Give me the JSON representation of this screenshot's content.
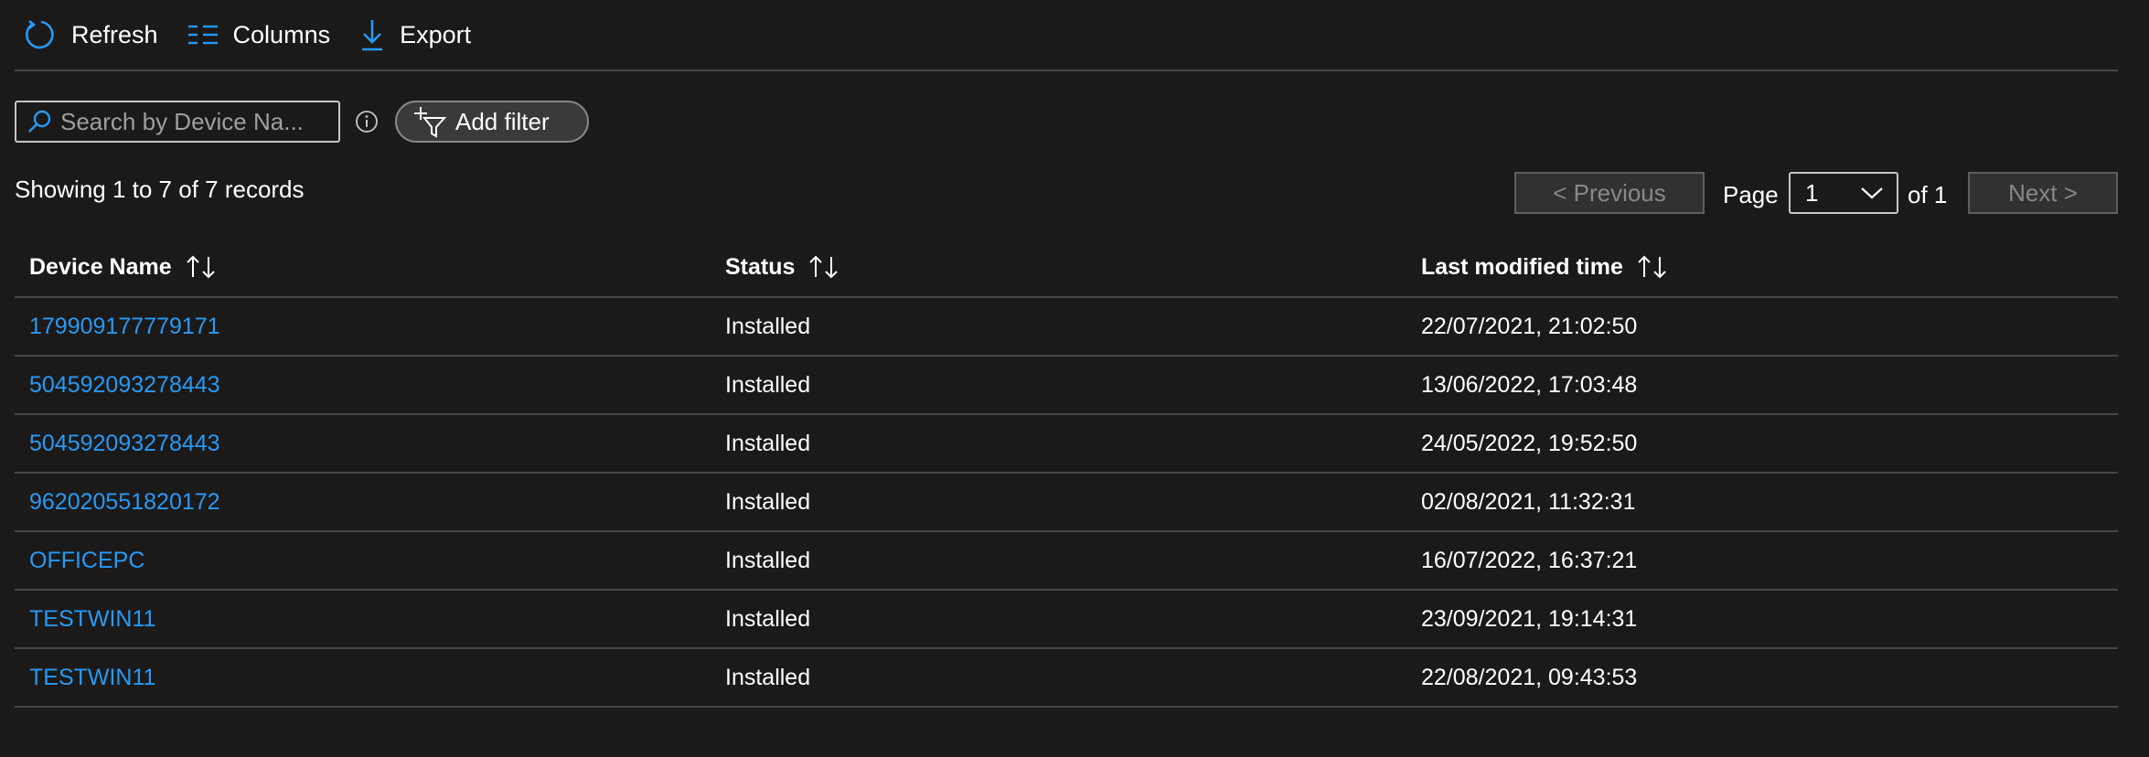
{
  "toolbar": {
    "refresh_label": "Refresh",
    "columns_label": "Columns",
    "export_label": "Export"
  },
  "filter": {
    "search_placeholder": "Search by Device Na...",
    "add_filter_label": "Add filter"
  },
  "records_text": "Showing 1 to 7 of 7 records",
  "pagination": {
    "previous_label": "< Previous",
    "page_label": "Page",
    "current_page": "1",
    "of_label": "of 1",
    "next_label": "Next >"
  },
  "table": {
    "headers": [
      "Device Name",
      "Status",
      "Last modified time"
    ],
    "rows": [
      [
        "179909177779171",
        "Installed",
        "22/07/2021, 21:02:50"
      ],
      [
        "504592093278443",
        "Installed",
        "13/06/2022, 17:03:48"
      ],
      [
        "504592093278443",
        "Installed",
        "24/05/2022, 19:52:50"
      ],
      [
        "962020551820172",
        "Installed",
        "02/08/2021, 11:32:31"
      ],
      [
        "OFFICEPC",
        "Installed",
        "16/07/2022, 16:37:21"
      ],
      [
        "TESTWIN11",
        "Installed",
        "23/09/2021, 19:14:31"
      ],
      [
        "TESTWIN11",
        "Installed",
        "22/08/2021, 09:43:53"
      ]
    ]
  },
  "colors": {
    "background": "#1b1a19",
    "accent": "#2899f5",
    "divider": "#484644"
  },
  "icons": [
    "refresh-icon",
    "columns-icon",
    "export-icon",
    "search-icon",
    "info-icon",
    "add-filter-icon",
    "chevron-down-icon",
    "sort-icon"
  ]
}
